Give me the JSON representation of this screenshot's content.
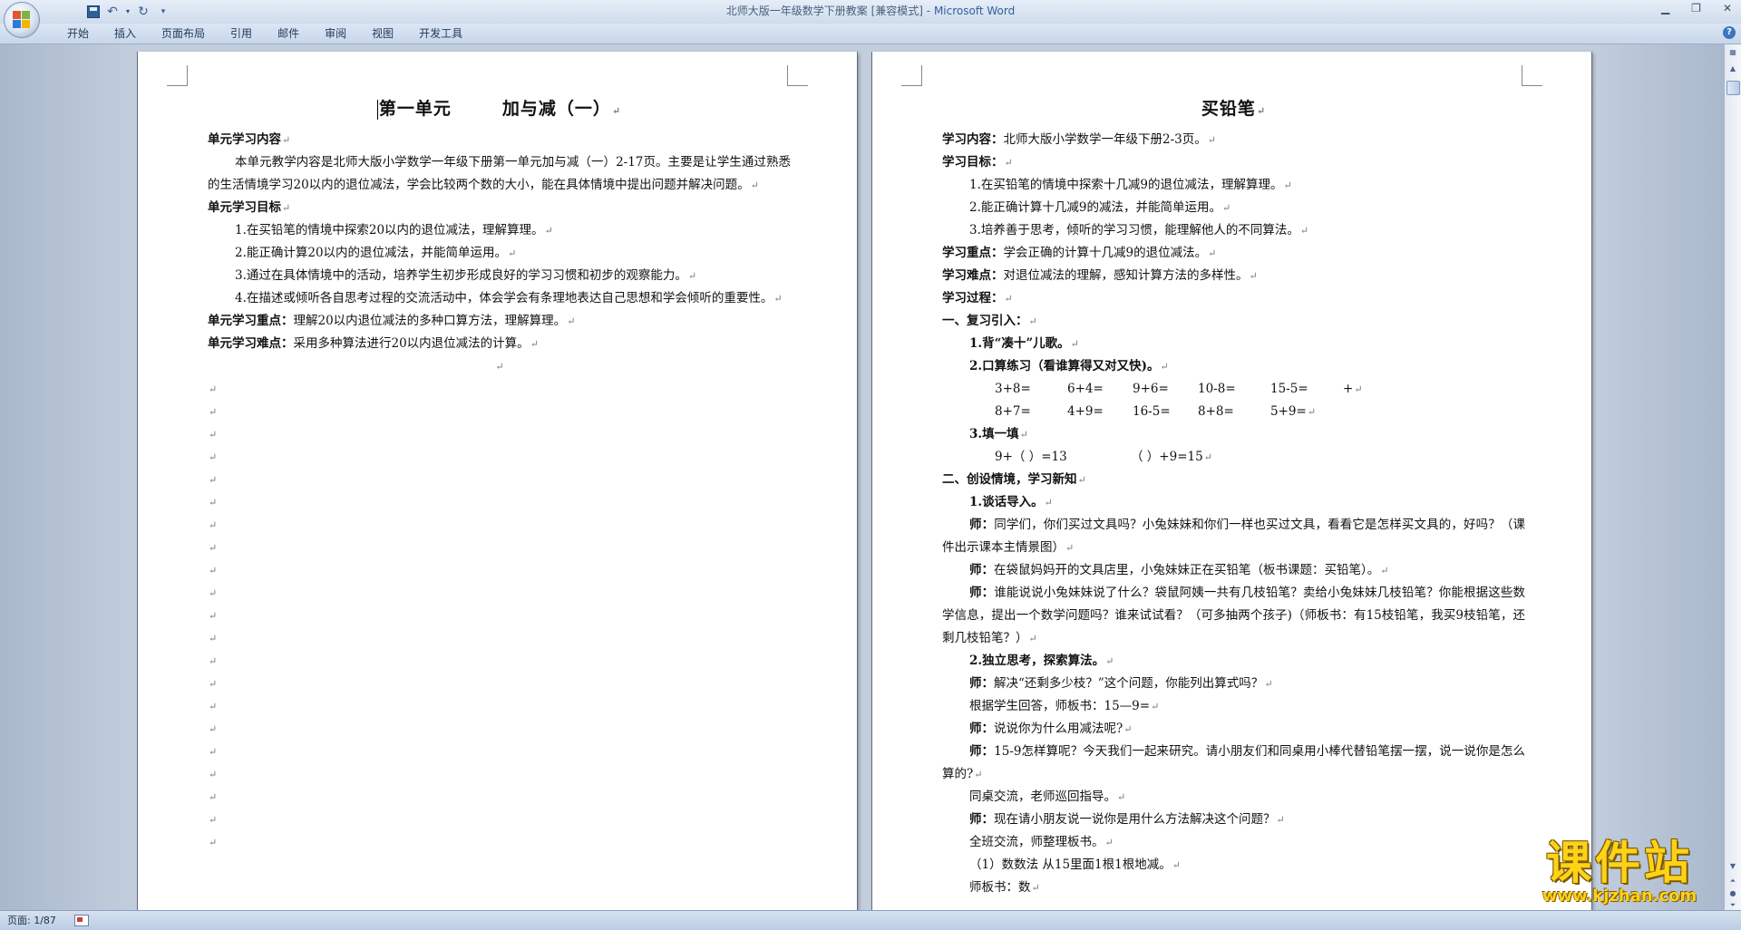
{
  "window": {
    "title_doc": "北师大版一年级数学下册教案 [兼容模式]",
    "title_sep": " - ",
    "title_app": "Microsoft Word"
  },
  "quick_access": {
    "icons": [
      "office-button",
      "save-icon",
      "undo-icon",
      "redo-icon",
      "customize-dropdown-icon"
    ]
  },
  "ribbon": {
    "tabs": [
      "开始",
      "插入",
      "页面布局",
      "引用",
      "邮件",
      "审阅",
      "视图",
      "开发工具"
    ]
  },
  "left_page": {
    "title_part1": "第一单元",
    "title_part2": "加与减（一）",
    "content_label": "单元学习内容",
    "content_text": "本单元教学内容是北师大版小学数学一年级下册第一单元加与减（一）2-17页。主要是让学生通过熟悉的生活情境学习20以内的退位减法，学会比较两个数的大小，能在具体情境中提出问题并解决问题。",
    "goals_label": "单元学习目标",
    "goals": [
      "1.在买铅笔的情境中探索20以内的退位减法，理解算理。",
      "2.能正确计算20以内的退位减法，并能简单运用。",
      "3.通过在具体情境中的活动，培养学生初步形成良好的学习习惯和初步的观察能力。",
      "4.在描述或倾听各自思考过程的交流活动中，体会学会有条理地表达自己思想和学会倾听的重要性。"
    ],
    "key_label": "单元学习重点：",
    "key_text": "理解20以内退位减法的多种口算方法，理解算理。",
    "difficulty_label": "单元学习难点：",
    "difficulty_text": "采用多种算法进行20以内退位减法的计算。"
  },
  "right_page": {
    "title": "买铅笔",
    "content_label": "学习内容：",
    "content_text": "北师大版小学数学一年级下册2-3页。",
    "goals_label": "学习目标：",
    "goals": [
      "1.在买铅笔的情境中探索十几减9的退位减法，理解算理。",
      "2.能正确计算十几减9的减法，并能简单运用。",
      "3.培养善于思考，倾听的学习习惯，能理解他人的不同算法。"
    ],
    "key_label": "学习重点：",
    "key_text": "学会正确的计算十几减9的退位减法。",
    "difficulty_label": "学习难点：",
    "difficulty_text": "对退位减法的理解，感知计算方法的多样性。",
    "process_label": "学习过程：",
    "section1": "一、复习引入：",
    "s1_item1": "1.背“凑十”儿歌。",
    "s1_item2": "2.口算练习（看谁算得又对又快)。",
    "calc_row1": [
      "3+8=",
      "6+4=",
      "9+6=",
      "10-8=",
      "15-5=",
      "+"
    ],
    "calc_row2": [
      "8+7=",
      "4+9=",
      "16-5=",
      "8+8=",
      "5+9="
    ],
    "s1_item3": "3.填一填",
    "fill_row": [
      "9+（    ）=13",
      "（    ）+9=15"
    ],
    "section2": "二、创设情境，学习新知",
    "s2_item1": "1.谈话导入。",
    "teacher": "师：",
    "t1": "同学们，你们买过文具吗？小兔妹妹和你们一样也买过文具，看看它是怎样买文具的，好吗？（课件出示课本主情景图）",
    "t2": "在袋鼠妈妈开的文具店里，小兔妹妹正在买铅笔（板书课题：买铅笔）。",
    "t3": "谁能说说小兔妹妹说了什么？袋鼠阿姨一共有几枝铅笔？卖给小兔妹妹几枝铅笔？你能根据这些数学信息，提出一个数学问题吗？谁来试试看？（可多抽两个孩子)（师板书：有15枝铅笔，我买9枝铅笔，还剩几枝铅笔？）",
    "s2_item2": "2.独立思考，探索算法。",
    "t4": "解决“还剩多少枝？”这个问题，你能列出算式吗？",
    "l_board": "根据学生回答，师板书：15—9=",
    "t5": "说说你为什么用减法呢?",
    "t6": "15-9怎样算呢？今天我们一起来研究。请小朋友们和同桌用小棒代替铅笔摆一摆，说一说你是怎么算的?",
    "l_exchange": "同桌交流，老师巡回指导。",
    "t7": "现在请小朋友说一说你是用什么方法解决这个问题？",
    "l_class": "全班交流，师整理板书。",
    "l_method1": "（1）数数法   从15里面1根1根地减。",
    "l_board2": "师板书：数"
  },
  "status": {
    "page_count": "页面: 1/87"
  },
  "watermark": {
    "text": "课件站",
    "url": "www.kjzhan.com"
  },
  "paragraph_mark": "↵",
  "colors": {
    "title_app": "#355f9e",
    "watermark": "#ffd21a",
    "ribbon_text": "#1e395b"
  }
}
